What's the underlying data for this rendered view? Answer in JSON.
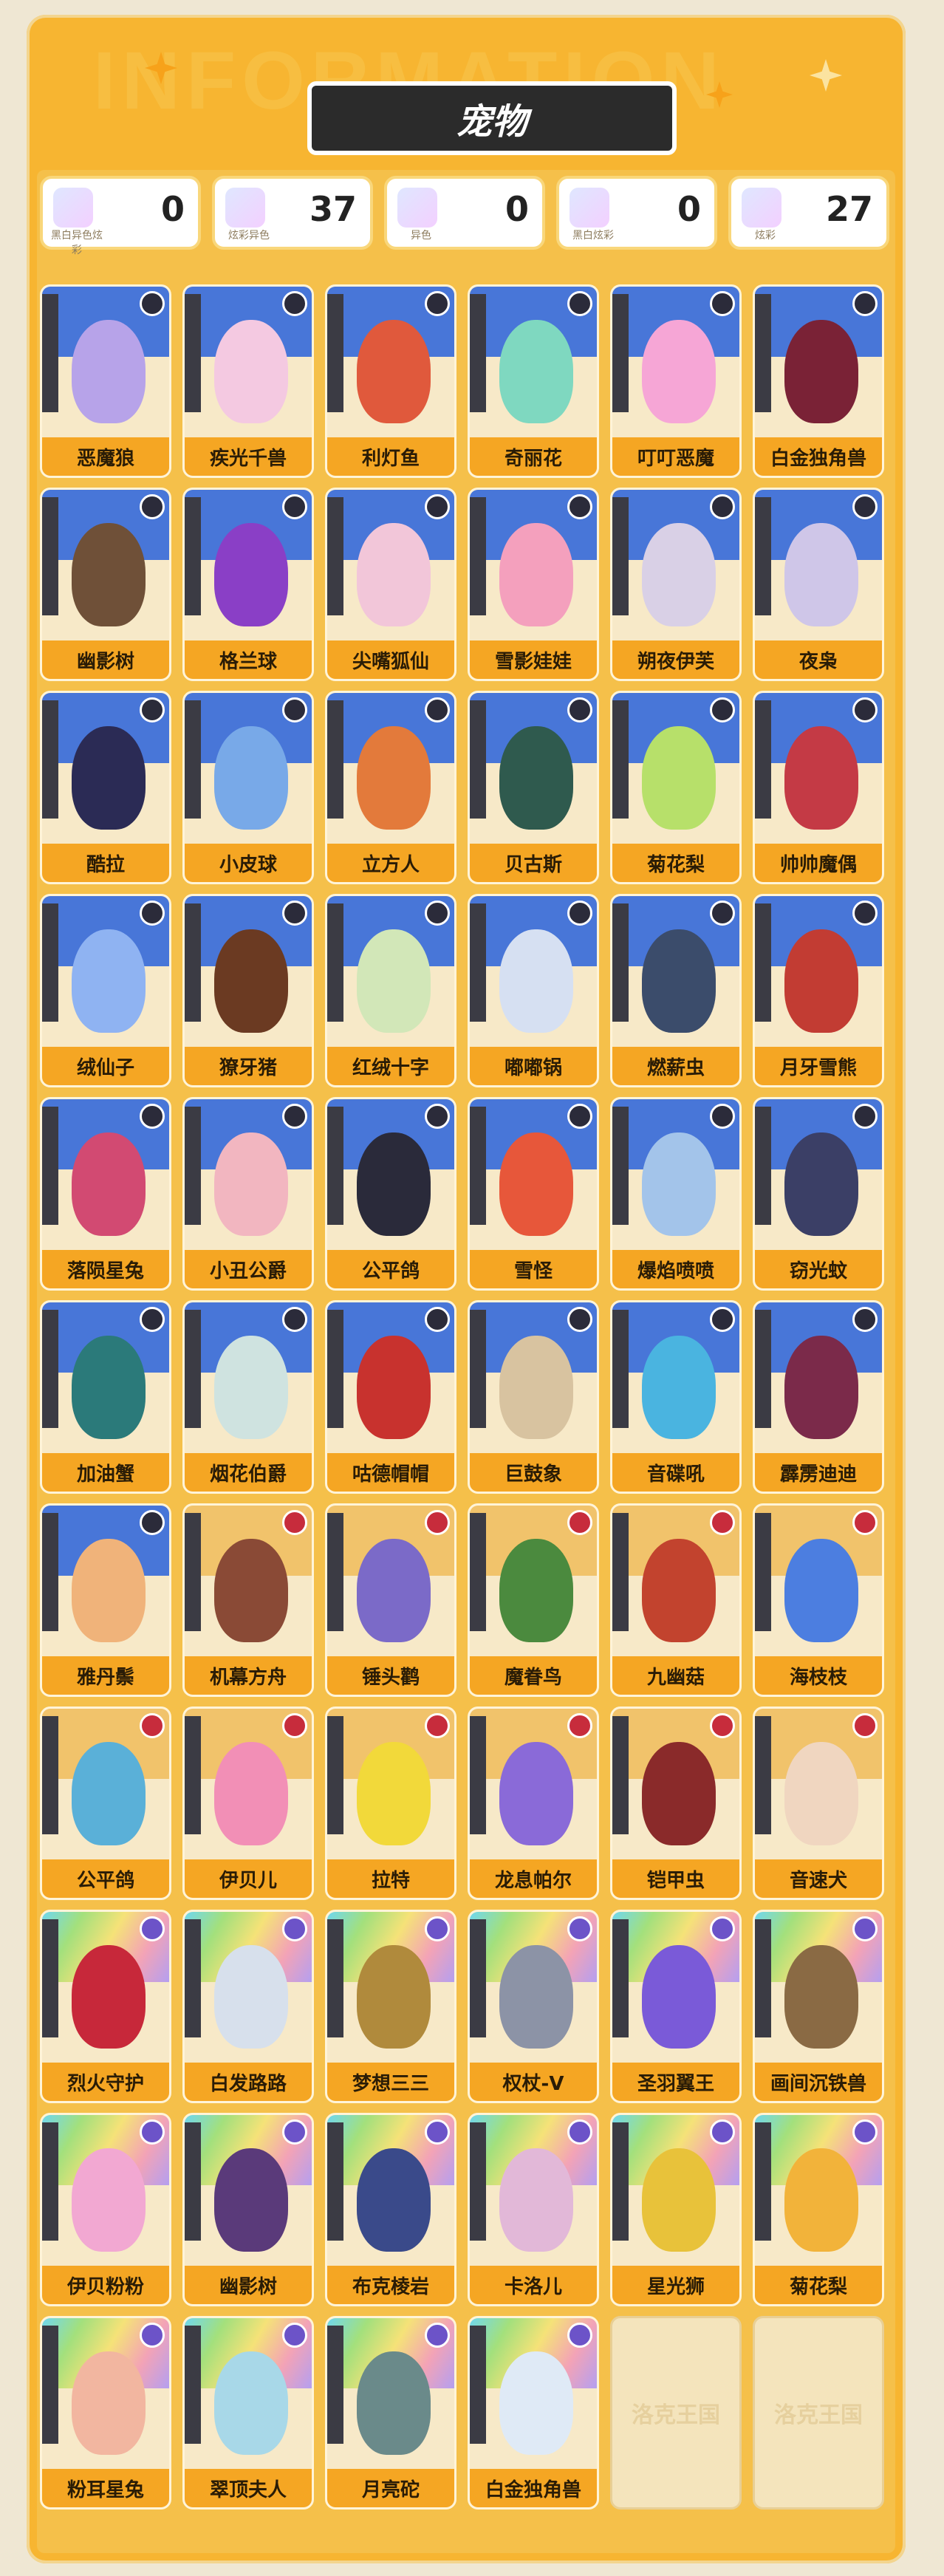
{
  "header": {
    "title": "宠物",
    "watermark": "INFORMATION"
  },
  "stats": [
    {
      "label": "黑白异色炫彩",
      "value": "0",
      "icon": "bw-shiny-rainbow-icon"
    },
    {
      "label": "炫彩异色",
      "value": "37",
      "icon": "rainbow-shiny-icon"
    },
    {
      "label": "异色",
      "value": "0",
      "icon": "shiny-icon"
    },
    {
      "label": "黑白炫彩",
      "value": "0",
      "icon": "bw-rainbow-icon"
    },
    {
      "label": "炫彩",
      "value": "27",
      "icon": "rainbow-icon"
    }
  ],
  "pets": [
    {
      "name": "恶魔狼",
      "color": "#b7a3e9",
      "type": "blue"
    },
    {
      "name": "疾光千兽",
      "color": "#f4c9e1",
      "type": "blue"
    },
    {
      "name": "利灯鱼",
      "color": "#e0593c",
      "type": "blue"
    },
    {
      "name": "奇丽花",
      "color": "#7fd8c0",
      "type": "blue"
    },
    {
      "name": "叮叮恶魔",
      "color": "#f6a6d6",
      "type": "blue"
    },
    {
      "name": "白金独角兽",
      "color": "#7a2236",
      "type": "blue"
    },
    {
      "name": "幽影树",
      "color": "#6f5038",
      "type": "blue"
    },
    {
      "name": "格兰球",
      "color": "#8a3fc6",
      "type": "blue"
    },
    {
      "name": "尖嘴狐仙",
      "color": "#f2c6d9",
      "type": "blue"
    },
    {
      "name": "雪影娃娃",
      "color": "#f4a0bd",
      "type": "blue"
    },
    {
      "name": "朔夜伊芙",
      "color": "#d9d0e6",
      "type": "blue"
    },
    {
      "name": "夜枭",
      "color": "#cfc6e8",
      "type": "blue"
    },
    {
      "name": "酷拉",
      "color": "#2b2b55",
      "type": "blue"
    },
    {
      "name": "小皮球",
      "color": "#78a9e8",
      "type": "blue"
    },
    {
      "name": "立方人",
      "color": "#e37a3b",
      "type": "blue"
    },
    {
      "name": "贝古斯",
      "color": "#2f5a4e",
      "type": "blue"
    },
    {
      "name": "菊花梨",
      "color": "#b7e06a",
      "type": "blue"
    },
    {
      "name": "帅帅魔偶",
      "color": "#c43a45",
      "type": "blue"
    },
    {
      "name": "绒仙子",
      "color": "#8fb3f2",
      "type": "blue"
    },
    {
      "name": "獠牙猪",
      "color": "#6b3a22",
      "type": "blue"
    },
    {
      "name": "红绒十字",
      "color": "#d2e7b8",
      "type": "blue"
    },
    {
      "name": "嘟嘟锅",
      "color": "#d6e0f2",
      "type": "blue"
    },
    {
      "name": "燃薪虫",
      "color": "#3b4c6b",
      "type": "blue"
    },
    {
      "name": "月牙雪熊",
      "color": "#c23c33",
      "type": "blue"
    },
    {
      "name": "落陨星兔",
      "color": "#d24a72",
      "type": "blue"
    },
    {
      "name": "小丑公爵",
      "color": "#f2b6c0",
      "type": "blue"
    },
    {
      "name": "公平鸽",
      "color": "#2a2a3a",
      "type": "blue"
    },
    {
      "name": "雪怪",
      "color": "#e7573a",
      "type": "blue"
    },
    {
      "name": "爆焰喷喷",
      "color": "#a3c4ea",
      "type": "blue"
    },
    {
      "name": "窃光蚊",
      "color": "#3b3f66",
      "type": "blue"
    },
    {
      "name": "加油蟹",
      "color": "#2b7a7a",
      "type": "blue"
    },
    {
      "name": "烟花伯爵",
      "color": "#cfe3e0",
      "type": "blue"
    },
    {
      "name": "咕德帽帽",
      "color": "#c8322e",
      "type": "blue"
    },
    {
      "name": "巨鼓象",
      "color": "#d8c3a0",
      "type": "blue"
    },
    {
      "name": "音碟吼",
      "color": "#4ab4e0",
      "type": "blue"
    },
    {
      "name": "霹雳迪迪",
      "color": "#7b2a4a",
      "type": "blue"
    },
    {
      "name": "雅丹鬃",
      "color": "#f0b37a",
      "type": "blue"
    },
    {
      "name": "机幕方舟",
      "color": "#8a4a36",
      "type": "red"
    },
    {
      "name": "锤头鹳",
      "color": "#7b6ac8",
      "type": "red"
    },
    {
      "name": "魔眷鸟",
      "color": "#4b8a3e",
      "type": "red"
    },
    {
      "name": "九幽菇",
      "color": "#c2432e",
      "type": "red"
    },
    {
      "name": "海枝枝",
      "color": "#4c7ee0",
      "type": "red"
    },
    {
      "name": "公平鸽",
      "color": "#5ab0d8",
      "type": "red"
    },
    {
      "name": "伊贝儿",
      "color": "#f28fb6",
      "type": "red"
    },
    {
      "name": "拉特",
      "color": "#f2d93a",
      "type": "red"
    },
    {
      "name": "龙息帕尔",
      "color": "#8a6ad8",
      "type": "red"
    },
    {
      "name": "铠甲虫",
      "color": "#8a2a2a",
      "type": "red"
    },
    {
      "name": "音速犬",
      "color": "#f0d6c0",
      "type": "red"
    },
    {
      "name": "烈火守护",
      "color": "#c7283a",
      "type": "rainbow"
    },
    {
      "name": "白发路路",
      "color": "#d7e0ec",
      "type": "rainbow"
    },
    {
      "name": "梦想三三",
      "color": "#b08a3c",
      "type": "rainbow"
    },
    {
      "name": "权杖-V",
      "color": "#8c93a6",
      "type": "rainbow"
    },
    {
      "name": "圣羽翼王",
      "color": "#7a5ad8",
      "type": "rainbow"
    },
    {
      "name": "画间沉铁兽",
      "color": "#8a6a44",
      "type": "rainbow"
    },
    {
      "name": "伊贝粉粉",
      "color": "#f2a8d2",
      "type": "rainbow"
    },
    {
      "name": "幽影树",
      "color": "#5a3a7a",
      "type": "rainbow"
    },
    {
      "name": "布克棱岩",
      "color": "#3a4a8a",
      "type": "rainbow"
    },
    {
      "name": "卡洛儿",
      "color": "#e2b8d8",
      "type": "rainbow"
    },
    {
      "name": "星光狮",
      "color": "#e8c23a",
      "type": "rainbow"
    },
    {
      "name": "菊花梨",
      "color": "#f2b33a",
      "type": "rainbow"
    },
    {
      "name": "粉耳星兔",
      "color": "#f2b6a0",
      "type": "rainbow"
    },
    {
      "name": "翠顶夫人",
      "color": "#a8d8e8",
      "type": "rainbow"
    },
    {
      "name": "月亮砣",
      "color": "#6a8a8a",
      "type": "rainbow"
    },
    {
      "name": "白金独角兽",
      "color": "#dfeaf6",
      "type": "rainbow"
    }
  ],
  "empty_slots": [
    "洛克王国",
    "洛克王国"
  ]
}
